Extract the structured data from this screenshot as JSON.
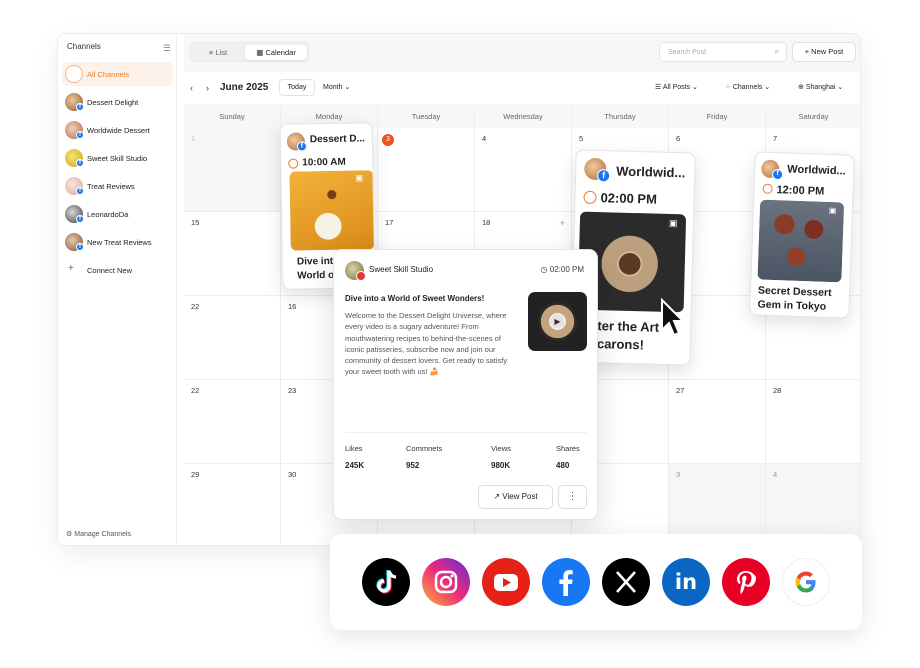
{
  "sidebar": {
    "title": "Channels",
    "items": [
      {
        "label": "All Channels",
        "active": true
      },
      {
        "label": "Dessert Delight"
      },
      {
        "label": "Worldwide Dessert"
      },
      {
        "label": "Sweet Skill Studio"
      },
      {
        "label": "Treat Reviews"
      },
      {
        "label": "LeonardoDa"
      },
      {
        "label": "New Treat Reviews"
      }
    ],
    "connect_label": "Connect New",
    "manage_label": "Manage Channels"
  },
  "topbar": {
    "list_label": "List",
    "calendar_label": "Calendar",
    "search_placeholder": "Search Post",
    "new_post_label": "New Post"
  },
  "toolbar": {
    "month_title": "June 2025",
    "today_label": "Today",
    "view_label": "Month",
    "all_posts_label": "All Posts",
    "channels_label": "Channels",
    "timezone_label": "Shanghai"
  },
  "calendar": {
    "weekdays": [
      "Sunday",
      "Monday",
      "Tuesday",
      "Wednesday",
      "Thursday",
      "Friday",
      "Saturday"
    ],
    "weeks": [
      [
        "1",
        "2",
        "3",
        "4",
        "5",
        "6",
        "7"
      ],
      [
        "15",
        "16",
        "17",
        "18",
        "19",
        "20",
        "21"
      ],
      [
        "22",
        "16",
        "",
        "",
        "",
        "",
        ""
      ],
      [
        "22",
        "23",
        "",
        "",
        "",
        "27",
        "28"
      ],
      [
        "29",
        "30",
        "",
        "",
        "",
        "3",
        "4"
      ]
    ]
  },
  "cards": {
    "monday": {
      "channel": "Dessert D...",
      "time": "10:00 AM",
      "title": "Dive into a World o"
    },
    "thursday": {
      "channel": "Worldwid...",
      "time": "02:00 PM",
      "title": "ster the Art\nacarons!"
    },
    "saturday": {
      "channel": "Worldwid...",
      "time": "12:00 PM",
      "title": "Secret Dessert Gem in Tokyo"
    }
  },
  "popup": {
    "channel": "Sweet Skill Studio",
    "time": "02:00 PM",
    "title": "Dive into a World of Sweet Wonders!",
    "body": "Welcome to the Dessert Delight Universe, where every video is a sugary adventure! From mouthwatering recipes to behind-the-scenes of iconic patisseries, subscribe now and join our community of dessert lovers. Get ready to satisfy your sweet tooth with us! 🍰",
    "stats": [
      {
        "label": "Likes",
        "value": "245K"
      },
      {
        "label": "Commnets",
        "value": "952"
      },
      {
        "label": "Views",
        "value": "980K"
      },
      {
        "label": "Shares",
        "value": "480"
      }
    ],
    "view_post_label": "View Post",
    "more_label": "⋮"
  },
  "social": [
    {
      "name": "tiktok",
      "color": "#000000"
    },
    {
      "name": "instagram",
      "color": "#d6249f"
    },
    {
      "name": "youtube",
      "color": "#e62117"
    },
    {
      "name": "facebook",
      "color": "#1877f2"
    },
    {
      "name": "x",
      "color": "#000000"
    },
    {
      "name": "linkedin",
      "color": "#0a66c2"
    },
    {
      "name": "pinterest",
      "color": "#e60023"
    },
    {
      "name": "google",
      "color": "#4285f4"
    }
  ]
}
